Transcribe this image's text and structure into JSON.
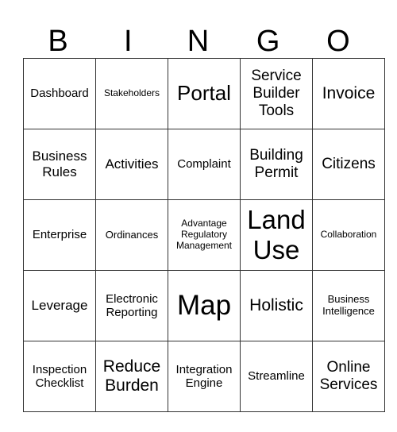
{
  "header": [
    "B",
    "I",
    "N",
    "G",
    "O"
  ],
  "cells": [
    [
      "Dashboard",
      "Stakeholders",
      "Portal",
      "Service Builder Tools",
      "Invoice"
    ],
    [
      "Business Rules",
      "Activities",
      "Complaint",
      "Building Permit",
      "Citizens"
    ],
    [
      "Enterprise",
      "Ordinances",
      "Advantage Regulatory Management",
      "Land Use",
      "Collaboration"
    ],
    [
      "Leverage",
      "Electronic Reporting",
      "Map",
      "Holistic",
      "Business Intelligence"
    ],
    [
      "Inspection Checklist",
      "Reduce Burden",
      "Integration Engine",
      "Streamline",
      "Online Services"
    ]
  ]
}
